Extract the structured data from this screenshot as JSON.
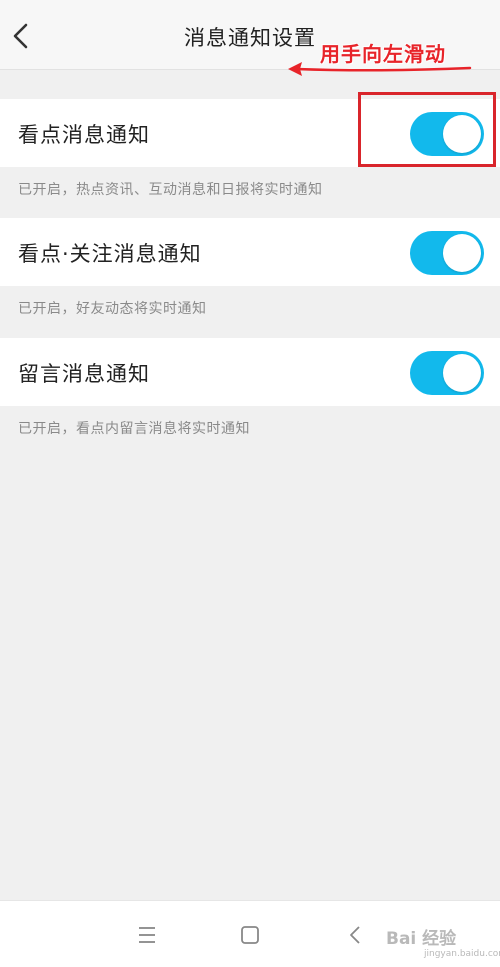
{
  "header": {
    "title": "消息通知设置",
    "back_icon": "chevron-left-icon"
  },
  "annotation": {
    "text": "用手向左滑动",
    "color": "#e8242a"
  },
  "settings": [
    {
      "label": "看点消息通知",
      "enabled": true,
      "description": "已开启，热点资讯、互动消息和日报将实时通知"
    },
    {
      "label": "看点·关注消息通知",
      "enabled": true,
      "description": "已开启，好友动态将实时通知"
    },
    {
      "label": "留言消息通知",
      "enabled": true,
      "description": "已开启，看点内留言消息将实时通知"
    }
  ],
  "colors": {
    "toggle_on": "#12b9ec",
    "highlight": "#d9252b",
    "background": "#f0f0f0"
  },
  "navbar": {
    "menu_icon": "menu-icon",
    "home_icon": "square-home-icon",
    "back_icon": "back-triangle-icon"
  },
  "watermark": {
    "text": "Bai 经验",
    "sub": "jingyan.baidu.com"
  }
}
